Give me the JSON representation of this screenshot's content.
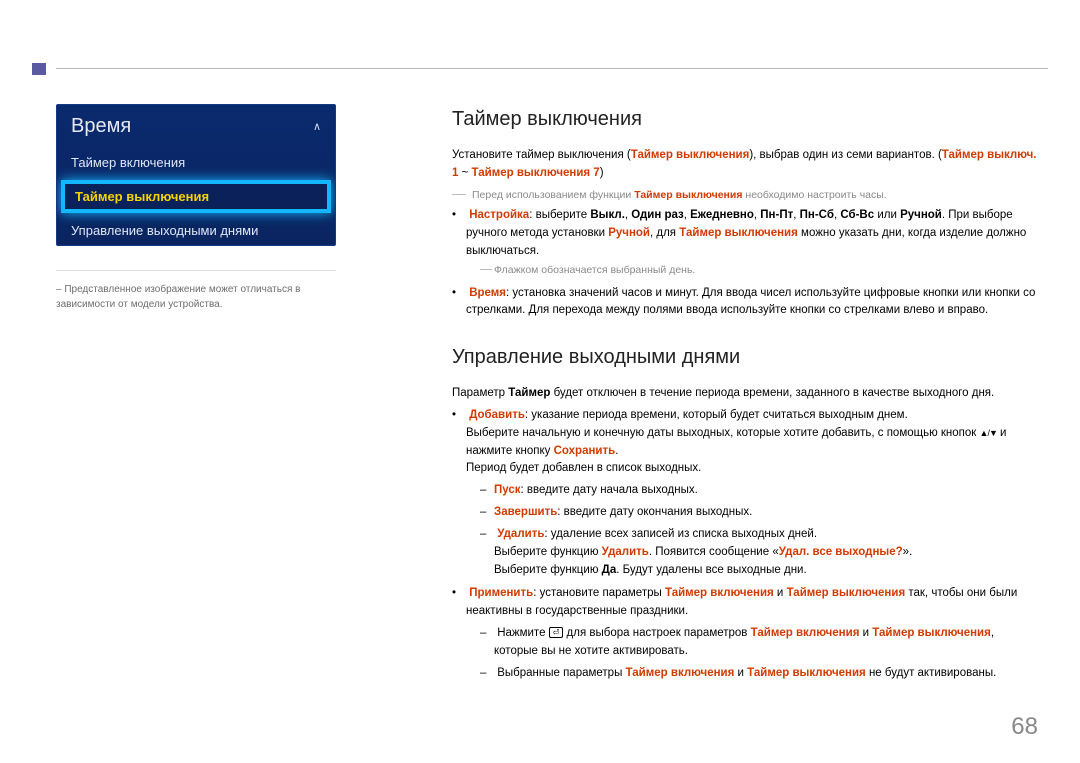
{
  "pagenum": "68",
  "sidebar": {
    "title": "Время",
    "items": [
      {
        "label": "Таймер включения",
        "selected": false
      },
      {
        "label": "Таймер выключения",
        "selected": true
      },
      {
        "label": "Управление выходными днями",
        "selected": false
      }
    ],
    "note_prefix": "‒ ",
    "note": "Представленное изображение может отличаться в зависимости от модели устройства."
  },
  "sec1": {
    "h": "Таймер выключения",
    "intro_a": "Установите таймер выключения (",
    "intro_b": "Таймер выключения",
    "intro_c": "), выбрав один из семи вариантов. (",
    "intro_d": "Таймер выключ. 1",
    "intro_e": " ~ ",
    "intro_f": "Таймер выключения 7",
    "intro_g": ")",
    "note1_a": "Перед использованием функции ",
    "note1_b": "Таймер выключения",
    "note1_c": " необходимо настроить часы.",
    "li1_a": "Настройка",
    "li1_b": ": выберите ",
    "li1_c": "Выкл.",
    "li1_d": ", ",
    "li1_e": "Один раз",
    "li1_f": ", ",
    "li1_g": "Ежедневно",
    "li1_h": ", ",
    "li1_i": "Пн-Пт",
    "li1_j": ", ",
    "li1_k": "Пн-Сб",
    "li1_l": ", ",
    "li1_m": "Сб-Вс",
    "li1_n": " или ",
    "li1_o": "Ручной",
    "li1_p": ". При выборе ручного метода установки ",
    "li1_q": "Ручной",
    "li1_r": ", для ",
    "li1_s": "Таймер выключения",
    "li1_t": " можно указать дни, когда изделие должно выключаться.",
    "note2": "Флажком обозначается выбранный день.",
    "li2_a": "Время",
    "li2_b": ": установка значений часов и минут. Для ввода чисел используйте цифровые кнопки или кнопки со стрелками. Для перехода между полями ввода используйте кнопки со стрелками влево и вправо."
  },
  "sec2": {
    "h": "Управление выходными днями",
    "intro_a": "Параметр ",
    "intro_b": "Таймер",
    "intro_c": " будет отключен в течение периода времени, заданного в качестве выходного дня.",
    "add_a": "Добавить",
    "add_b": ": указание периода времени, который будет считаться выходным днем.",
    "add_c": "Выберите начальную и конечную даты выходных, которые хотите добавить, с помощью кнопок ",
    "add_d": " и нажмите кнопку ",
    "add_e": "Сохранить",
    "add_f": ".",
    "add_g": "Период будет добавлен в список выходных.",
    "s_start_a": "Пуск",
    "s_start_b": ": введите дату начала выходных.",
    "s_end_a": "Завершить",
    "s_end_b": ": введите дату окончания выходных.",
    "s_del_a": "Удалить",
    "s_del_b": ": удаление всех записей из списка выходных дней.",
    "s_del_c": "Выберите функцию ",
    "s_del_d": "Удалить",
    "s_del_e": ". Появится сообщение «",
    "s_del_f": "Удал. все выходные?",
    "s_del_g": "».",
    "s_del_h": "Выберите функцию ",
    "s_del_i": "Да",
    "s_del_j": ". Будут удалены все выходные дни.",
    "apply_a": "Применить",
    "apply_b": ": установите параметры ",
    "apply_c": "Таймер включения",
    "apply_d": " и ",
    "apply_e": "Таймер выключения",
    "apply_f": " так, чтобы они были неактивны в государственные праздники.",
    "ap_s1_a": "Нажмите ",
    "ap_s1_b": " для выбора настроек параметров ",
    "ap_s1_c": "Таймер включения",
    "ap_s1_d": " и ",
    "ap_s1_e": "Таймер выключения",
    "ap_s1_f": ", которые вы не хотите активировать.",
    "ap_s2_a": "Выбранные параметры ",
    "ap_s2_b": "Таймер включения",
    "ap_s2_c": " и ",
    "ap_s2_d": "Таймер выключения",
    "ap_s2_e": " не будут активированы."
  }
}
